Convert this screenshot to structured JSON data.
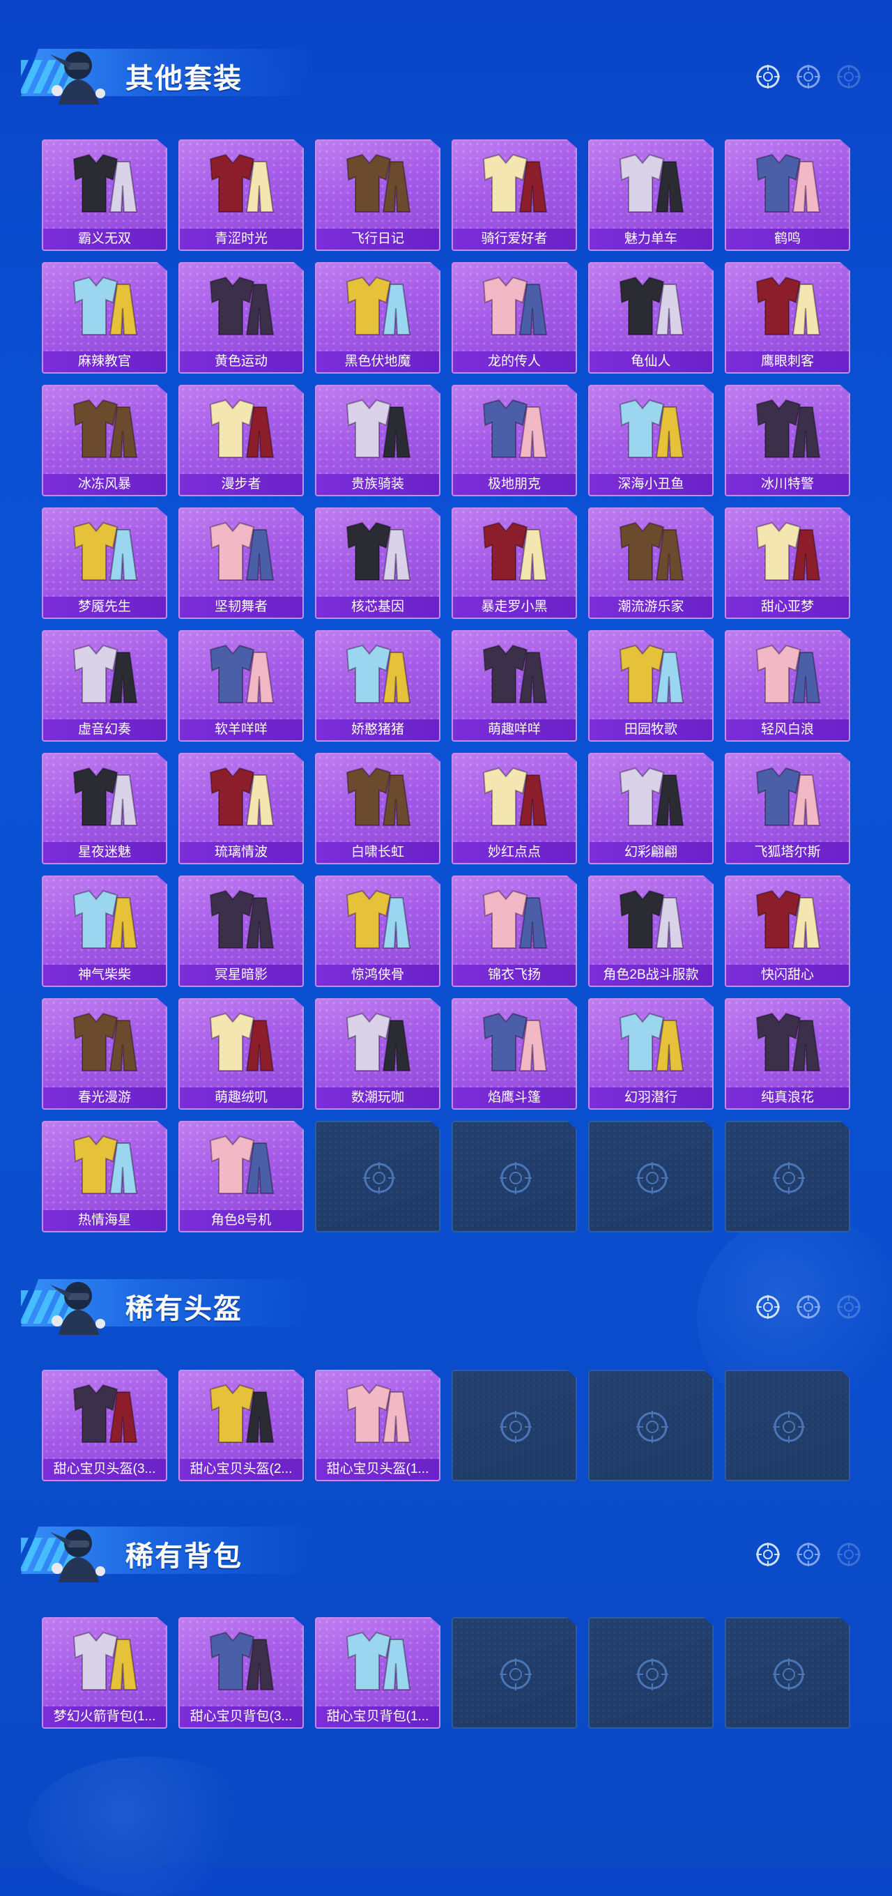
{
  "colors": {
    "background": "#0a4fd0",
    "card_purple": "#a55be8",
    "label_purple": "#7b2ed8",
    "empty_card": "#1e3a66"
  },
  "sections": [
    {
      "title": "其他套装",
      "icon": "soldier-mascot-icon",
      "items": [
        "霸义无双",
        "青涩时光",
        "飞行日记",
        "骑行爱好者",
        "魅力单车",
        "鹤鸣",
        "麻辣教官",
        "黄色运动",
        "黑色伏地魔",
        "龙的传人",
        "龟仙人",
        "鹰眼刺客",
        "冰冻风暴",
        "漫步者",
        "贵族骑装",
        "极地朋克",
        "深海小丑鱼",
        "冰川特警",
        "梦魇先生",
        "坚韧舞者",
        "核芯基因",
        "暴走罗小黑",
        "潮流游乐家",
        "甜心亚梦",
        "虚音幻奏",
        "软羊咩咩",
        "娇憨猪猪",
        "萌趣咩咩",
        "田园牧歌",
        "轻风白浪",
        "星夜迷魅",
        "琉璃情波",
        "白啸长虹",
        "妙红点点",
        "幻彩翩翩",
        "飞狐塔尔斯",
        "神气柴柴",
        "冥星暗影",
        "惊鸿侠骨",
        "锦衣飞扬",
        "角色2B战斗服款",
        "快闪甜心",
        "春光漫游",
        "萌趣绒叽",
        "数潮玩咖",
        "焰鹰斗篷",
        "幻羽潜行",
        "纯真浪花",
        "热情海星",
        "角色8号机"
      ],
      "empty_slots": 4
    },
    {
      "title": "稀有头盔",
      "icon": "soldier-mascot-icon",
      "items": [
        "甜心宝贝头盔(3...",
        "甜心宝贝头盔(2...",
        "甜心宝贝头盔(1..."
      ],
      "empty_slots": 3
    },
    {
      "title": "稀有背包",
      "icon": "soldier-mascot-icon",
      "items": [
        "梦幻火箭背包(1...",
        "甜心宝贝背包(3...",
        "甜心宝贝背包(1..."
      ],
      "empty_slots": 3
    }
  ]
}
